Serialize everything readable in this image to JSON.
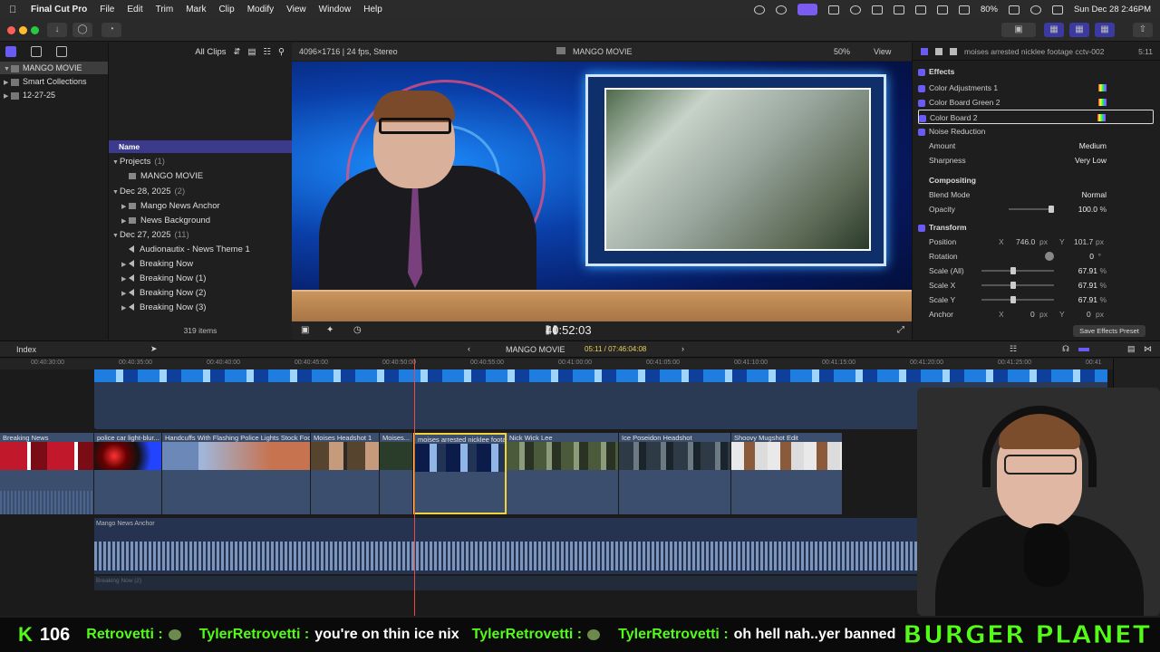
{
  "menubar": {
    "app_name": "Final Cut Pro",
    "menus": [
      "File",
      "Edit",
      "Trim",
      "Mark",
      "Clip",
      "Modify",
      "View",
      "Window",
      "Help"
    ],
    "battery": "80%",
    "datetime": "Sun Dec 28  2:46PM"
  },
  "library": {
    "items": [
      {
        "label": "MANGO MOVIE"
      },
      {
        "label": "Smart Collections"
      },
      {
        "label": "12-27-25"
      }
    ]
  },
  "browser": {
    "filter": "All Clips",
    "column_header": "Name",
    "rows": [
      {
        "label": "Projects",
        "count": "(1)"
      },
      {
        "label": "MANGO MOVIE"
      },
      {
        "label": "Dec 28, 2025",
        "count": "(2)"
      },
      {
        "label": "Mango News Anchor"
      },
      {
        "label": "News Background"
      },
      {
        "label": "Dec 27, 2025",
        "count": "(11)"
      },
      {
        "label": "Audionautix - News Theme 1"
      },
      {
        "label": "Breaking Now"
      },
      {
        "label": "Breaking Now (1)"
      },
      {
        "label": "Breaking Now (2)"
      },
      {
        "label": "Breaking Now (3)"
      }
    ],
    "item_count": "319 items"
  },
  "viewer": {
    "format": "4096×1716 | 24 fps, Stereo",
    "title": "MANGO MOVIE",
    "zoom": "50%",
    "view_label": "View",
    "timecode": "40:52:03"
  },
  "inspector": {
    "clip_name": "moises arrested nicklee footage cctv-002",
    "duration": "5:11",
    "effects_label": "Effects",
    "effects": [
      "Color Adjustments 1",
      "Color Board Green 2",
      "Color Board 2",
      "Noise Reduction"
    ],
    "amount_label": "Amount",
    "amount_value": "Medium",
    "sharpness_label": "Sharpness",
    "sharpness_value": "Very Low",
    "compositing_label": "Compositing",
    "blend_label": "Blend Mode",
    "blend_value": "Normal",
    "opacity_label": "Opacity",
    "opacity_value": "100.0",
    "opacity_unit": "%",
    "transform_label": "Transform",
    "position_label": "Position",
    "position_x": "746.0",
    "position_y": "101.7",
    "px": "px",
    "rotation_label": "Rotation",
    "rotation_value": "0",
    "degree": "°",
    "scale_all_label": "Scale (All)",
    "scale_all_value": "67.91",
    "scale_x_label": "Scale X",
    "scale_x_value": "67.91",
    "scale_y_label": "Scale Y",
    "scale_y_value": "67.91",
    "anchor_label": "Anchor",
    "anchor_x": "0",
    "anchor_y": "0",
    "axis_x": "X",
    "axis_y": "Y",
    "save_preset": "Save Effects Preset"
  },
  "timeline": {
    "index_label": "Index",
    "project": "MANGO MOVIE",
    "timecode": "05:11 / 07:46:04:08",
    "ruler": [
      "00:40:30:00",
      "00:40:35:00",
      "00:40:40:00",
      "00:40:45:00",
      "00:40:50:00",
      "00:40:55:00",
      "00:41:00:00",
      "00:41:05:00",
      "00:41:10:00",
      "00:41:15:00",
      "00:41:20:00",
      "00:41:25:00",
      "00:41"
    ],
    "clips": [
      {
        "name": "Breaking News"
      },
      {
        "name": "police car light-blur..."
      },
      {
        "name": "Handcuffs With Flashing Police Lights Stock Foo..."
      },
      {
        "name": "Moises Headshot 1"
      },
      {
        "name": "Moises..."
      },
      {
        "name": "moises arrested nicklee foota..."
      },
      {
        "name": "Nick Wick Lee"
      },
      {
        "name": "Ice Poseidon Headshot"
      },
      {
        "name": "Shoovy Mugshot Edit"
      }
    ],
    "audio_clip": "Mango News Anchor",
    "audio_clip_2": "Breaking Now (2)"
  },
  "chat": {
    "viewer_count": "106",
    "messages": [
      {
        "user": "Retrovetti :",
        "text": ""
      },
      {
        "user": "TylerRetrovetti :",
        "text": "you're on thin ice nix"
      },
      {
        "user": "TylerRetrovetti :",
        "text": ""
      },
      {
        "user": "TylerRetrovetti :",
        "text": "oh hell nah..yer banned"
      }
    ],
    "brand": "BURGER PLANET"
  },
  "colors": {
    "accent": "#6b5bf5",
    "selection": "#f3d13a",
    "kick_green": "#53fc18",
    "playhead": "#e84a4a"
  }
}
